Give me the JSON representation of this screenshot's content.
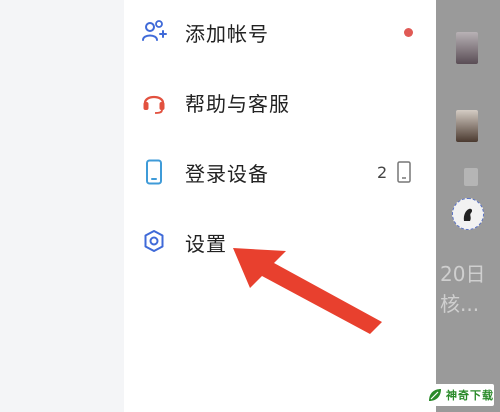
{
  "menu": {
    "items": [
      {
        "label": "添加帐号",
        "icon": "add-user-icon"
      },
      {
        "label": "帮助与客服",
        "icon": "headset-icon"
      },
      {
        "label": "登录设备",
        "icon": "phone-icon",
        "count": "2"
      },
      {
        "label": "设置",
        "icon": "gear-icon"
      }
    ]
  },
  "background": {
    "date_fragment": "20日",
    "text_fragment": "核..."
  },
  "watermark": {
    "text": "神奇下载"
  },
  "colors": {
    "icon_blue": "#3f6ad8",
    "icon_red": "#e2513f",
    "badge_dot": "#e05a55",
    "annotation_arrow": "#e8402e",
    "watermark_green": "#2a8a2a"
  }
}
